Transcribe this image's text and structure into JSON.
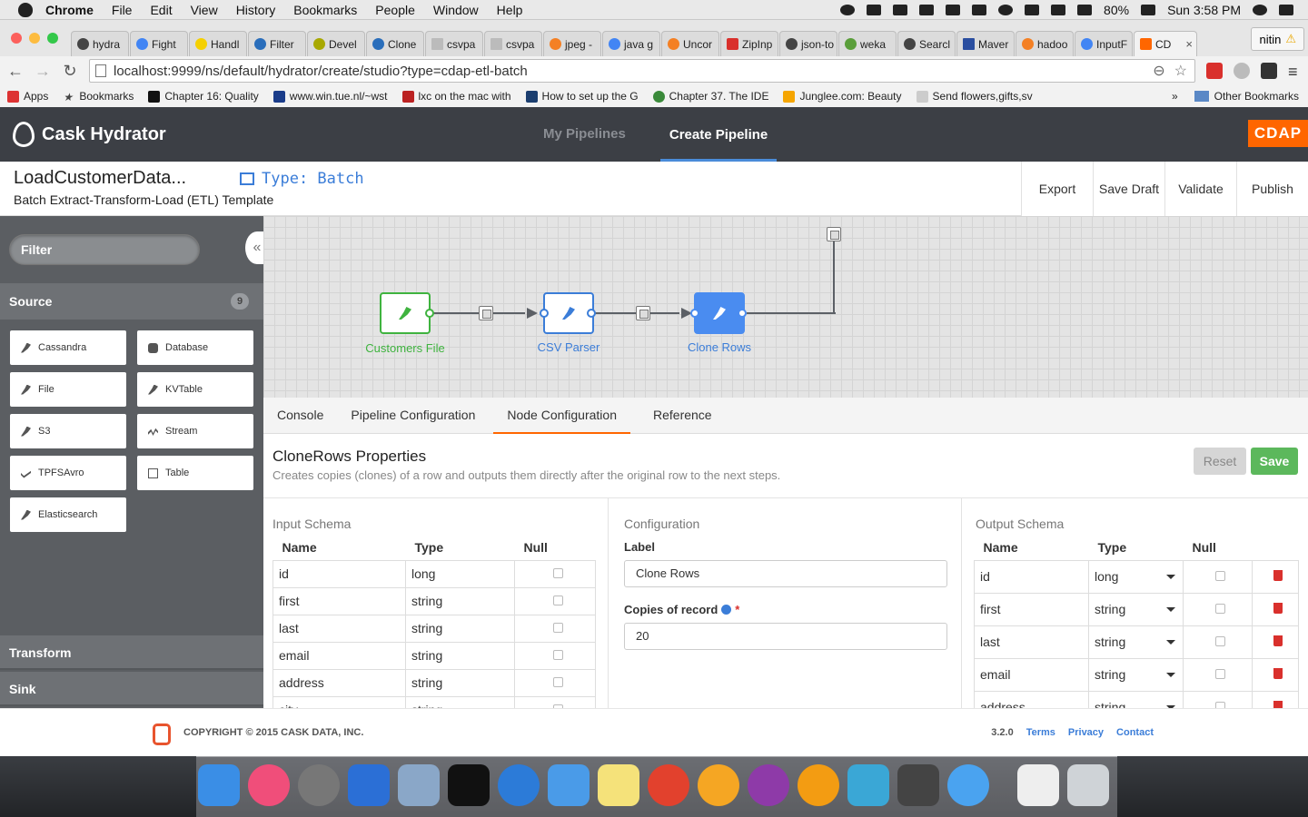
{
  "macbar": {
    "app": "Chrome",
    "menus": [
      "File",
      "Edit",
      "View",
      "History",
      "Bookmarks",
      "People",
      "Window",
      "Help"
    ],
    "battery": "80%",
    "clock": "Sun 3:58 PM"
  },
  "browser": {
    "tabs": [
      "hydra",
      "Fight",
      "Handl",
      "Filter",
      "Devel",
      "Clone",
      "csvpa",
      "csvpa",
      "jpeg -",
      "java g",
      "Uncor",
      "ZipInp",
      "json-to",
      "weka",
      "Searcl",
      "Maver",
      "hadoo",
      "InputF",
      "CD"
    ],
    "profile": "nitin",
    "url": "localhost:9999/ns/default/hydrator/create/studio?type=cdap-etl-batch",
    "bookmarks": [
      "Apps",
      "Bookmarks",
      "Chapter 16: Quality",
      "www.win.tue.nl/~wst",
      "lxc on the mac with",
      "How to set up the G",
      "Chapter 37. The IDE",
      "Junglee.com: Beauty",
      "Send flowers,gifts,sv"
    ],
    "bookmarks_more": "»",
    "other_bookmarks": "Other Bookmarks"
  },
  "app": {
    "brand": "Cask Hydrator",
    "nav": [
      "My Pipelines",
      "Create Pipeline"
    ],
    "badge": "CDAP",
    "pipeline": {
      "name": "LoadCustomerData...",
      "description": "Batch Extract-Transform-Load (ETL) Template",
      "type": "Type: Batch"
    },
    "actions": [
      "Export",
      "Save Draft",
      "Validate",
      "Publish"
    ]
  },
  "sidebar": {
    "filter_placeholder": "Filter",
    "collapse": "«",
    "source": {
      "label": "Source",
      "count": "9"
    },
    "plugins": [
      "Cassandra",
      "Database",
      "File",
      "KVTable",
      "S3",
      "Stream",
      "TPFSAvro",
      "Table",
      "Elasticsearch"
    ],
    "transform": "Transform",
    "sink": "Sink"
  },
  "canvas": {
    "nodes": [
      "Customers File",
      "CSV Parser",
      "Clone Rows"
    ],
    "colors": {
      "source": "#3fb33f",
      "transform": "#3b7dd8",
      "active": "#4a8cf0"
    }
  },
  "bottom_tabs": [
    "Console",
    "Pipeline Configuration",
    "Node Configuration",
    "Reference"
  ],
  "properties": {
    "title": "CloneRows Properties",
    "subtitle": "Creates copies (clones) of a row and outputs them directly after the original row to the next steps.",
    "reset": "Reset",
    "save": "Save",
    "input_schema": {
      "title": "Input Schema",
      "headers": [
        "Name",
        "Type",
        "Null"
      ],
      "rows": [
        [
          "id",
          "long"
        ],
        [
          "first",
          "string"
        ],
        [
          "last",
          "string"
        ],
        [
          "email",
          "string"
        ],
        [
          "address",
          "string"
        ],
        [
          "city",
          "string"
        ]
      ]
    },
    "configuration": {
      "title": "Configuration",
      "label_title": "Label",
      "label_value": "Clone Rows",
      "copies_title": "Copies of record",
      "copies_value": "20"
    },
    "output_schema": {
      "title": "Output Schema",
      "headers": [
        "Name",
        "Type",
        "Null"
      ],
      "rows": [
        [
          "id",
          "long"
        ],
        [
          "first",
          "string"
        ],
        [
          "last",
          "string"
        ],
        [
          "email",
          "string"
        ],
        [
          "address",
          "string"
        ]
      ]
    }
  },
  "footer": {
    "copyright": "COPYRIGHT © 2015 CASK DATA, INC.",
    "version": "3.2.0",
    "links": [
      "Terms",
      "Privacy",
      "Contact"
    ]
  }
}
